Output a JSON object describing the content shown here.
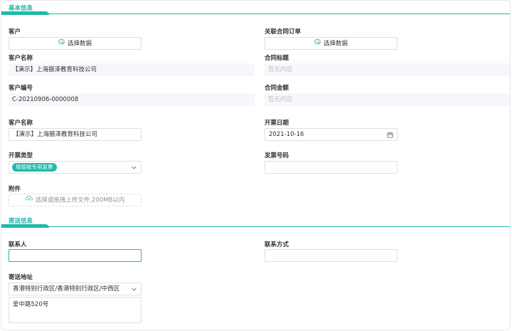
{
  "sections": {
    "basic_info": "基本信息",
    "shipping_info": "寄送信息"
  },
  "left": {
    "customer_label": "客户",
    "customer_select_button": "选择数据",
    "customer_name_label": "客户名称",
    "customer_name_value": "【演示】上海振泽教育科技公司",
    "customer_code_label": "客户编号",
    "customer_code_value": "C-20210906-0000008",
    "invoice_customer_name_label": "客户名称",
    "invoice_customer_name_value": "【演示】上海振泽教育科技公司",
    "invoice_type_label": "开票类型",
    "invoice_type_value": "增值税专用发票",
    "attachment_label": "附件",
    "attachment_upload_text": "选择或拖拽上传文件,200MB以内"
  },
  "right": {
    "contract_order_label": "关联合同订单",
    "contract_select_button": "选择数据",
    "contract_title_label": "合同标题",
    "contract_title_placeholder": "暂无内容",
    "contract_amount_label": "合同金额",
    "contract_amount_placeholder": "暂无内容",
    "invoice_date_label": "开票日期",
    "invoice_date_value": "2021-10-16",
    "invoice_number_label": "发票号码",
    "invoice_number_value": ""
  },
  "shipping": {
    "contact_label": "联系人",
    "contact_value": "",
    "contact_method_label": "联系方式",
    "contact_method_value": "",
    "address_label": "寄送地址",
    "region_value": "香港特别行政区/香港特别行政区/中西区",
    "street_value": "爱中路520号"
  },
  "colors": {
    "accent": "#22b8a9",
    "border": "#dcdfe6",
    "readonly_bg": "#f5f7fa",
    "placeholder": "#c0c4cc"
  },
  "icons": {
    "select_data": "cube-pointer-icon",
    "calendar": "calendar-icon",
    "dropdown": "chevron-down-icon",
    "upload": "cloud-upload-icon"
  }
}
